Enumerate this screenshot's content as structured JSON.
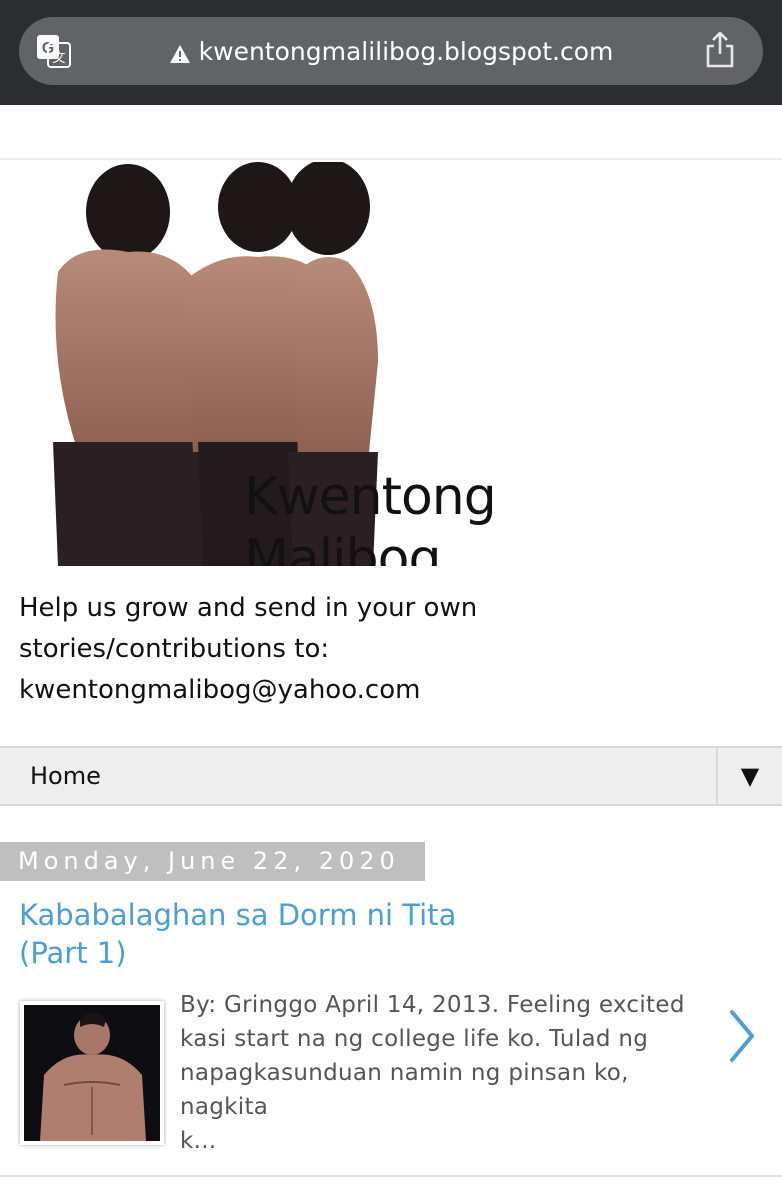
{
  "browser": {
    "url": "kwentongmalilibog.blogspot.com"
  },
  "header": {
    "image_line1": "Kwentong",
    "image_line2": "Malibog",
    "description_line1": "Help us grow and send in your own",
    "description_line2": "stories/contributions to:",
    "description_line3": "kwentongmalibog@yahoo.com"
  },
  "nav": {
    "home_label": "Home",
    "toggle_glyph": "▼"
  },
  "post": {
    "date": "Monday, June 22, 2020",
    "title_line1": "Kababalaghan sa Dorm ni Tita",
    "title_line2": "(Part 1)",
    "snippet_line1": "By: Gringgo April 14, 2013. Feeling excited",
    "snippet_line2": "kasi start na ng college life ko. Tulad ng",
    "snippet_line3": "napagkasunduan namin ng pinsan ko, nagkita",
    "snippet_line4": "k..."
  },
  "colors": {
    "browser_bar": "#2c2d30",
    "url_pill": "#626366",
    "link": "#4a9fd8",
    "date_bg": "#bfbfbf",
    "nav_bg": "#eeeeee"
  },
  "icons": [
    "translate-icon",
    "warning-icon",
    "share-icon",
    "next-arrow-icon"
  ]
}
